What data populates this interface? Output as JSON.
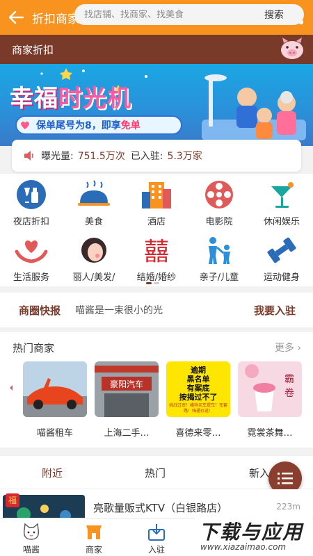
{
  "topbar": {
    "title": "折扣商家-喵酱上海"
  },
  "search": {
    "label": "商家折扣",
    "placeholder": "找店铺、找商家、找美食",
    "button": "搜索"
  },
  "banner": {
    "headline_a": "幸福",
    "headline_b": "时光机",
    "pill": "保单尾号为8，即享",
    "pill_free": "免单"
  },
  "stats": {
    "exposure_label": "曝光量:",
    "exposure_value": "751.5万次",
    "joined_label": "已入驻:",
    "joined_value": "5.3万家"
  },
  "categories": [
    {
      "label": "夜店折扣",
      "icon": "wine-icon"
    },
    {
      "label": "美食",
      "icon": "dish-icon"
    },
    {
      "label": "酒店",
      "icon": "hotel-icon"
    },
    {
      "label": "电影院",
      "icon": "film-reel-icon"
    },
    {
      "label": "休闲娱乐",
      "icon": "cocktail-icon"
    },
    {
      "label": "生活服务",
      "icon": "heart-hands-icon"
    },
    {
      "label": "丽人/美发/",
      "icon": "woman-icon"
    },
    {
      "label": "结婚/婚纱",
      "icon": "double-happiness-icon"
    },
    {
      "label": "亲子/儿童",
      "icon": "parent-child-icon"
    },
    {
      "label": "运动健身",
      "icon": "dumbbell-icon"
    }
  ],
  "news": {
    "tag": "商圈快报",
    "text": "喵酱是一束很小的光",
    "join": "我要入驻"
  },
  "hot": {
    "title": "热门商家",
    "more": "更多",
    "cards": [
      {
        "name": "喵酱租车"
      },
      {
        "name": "上海二手…"
      },
      {
        "name": "喜德来零…"
      },
      {
        "name": "霓裳茶舞…"
      }
    ],
    "card3_text": [
      "逾期",
      "黑名单",
      "有案底",
      "按揭过不了"
    ],
    "card3_sub": "挑战过审！横祥买车提车！无套路！嗨通价返！"
  },
  "tabs": {
    "near": "附近",
    "hot": "热门",
    "new": "新入"
  },
  "list": {
    "badge": "福",
    "name": "亮歌量贩式KTV（白银路店）",
    "distance": "223m"
  },
  "bottom_nav": [
    {
      "label": "喵酱",
      "icon": "cat-icon"
    },
    {
      "label": "商家",
      "icon": "shop-icon"
    },
    {
      "label": "入驻",
      "icon": "join-icon"
    }
  ],
  "watermark": {
    "big": "下载与应用",
    "small": "www.xiazaimao.com"
  },
  "colors": {
    "orange": "#f7931e",
    "brown": "#7a3a2a",
    "accent_red": "#e05a5a"
  }
}
